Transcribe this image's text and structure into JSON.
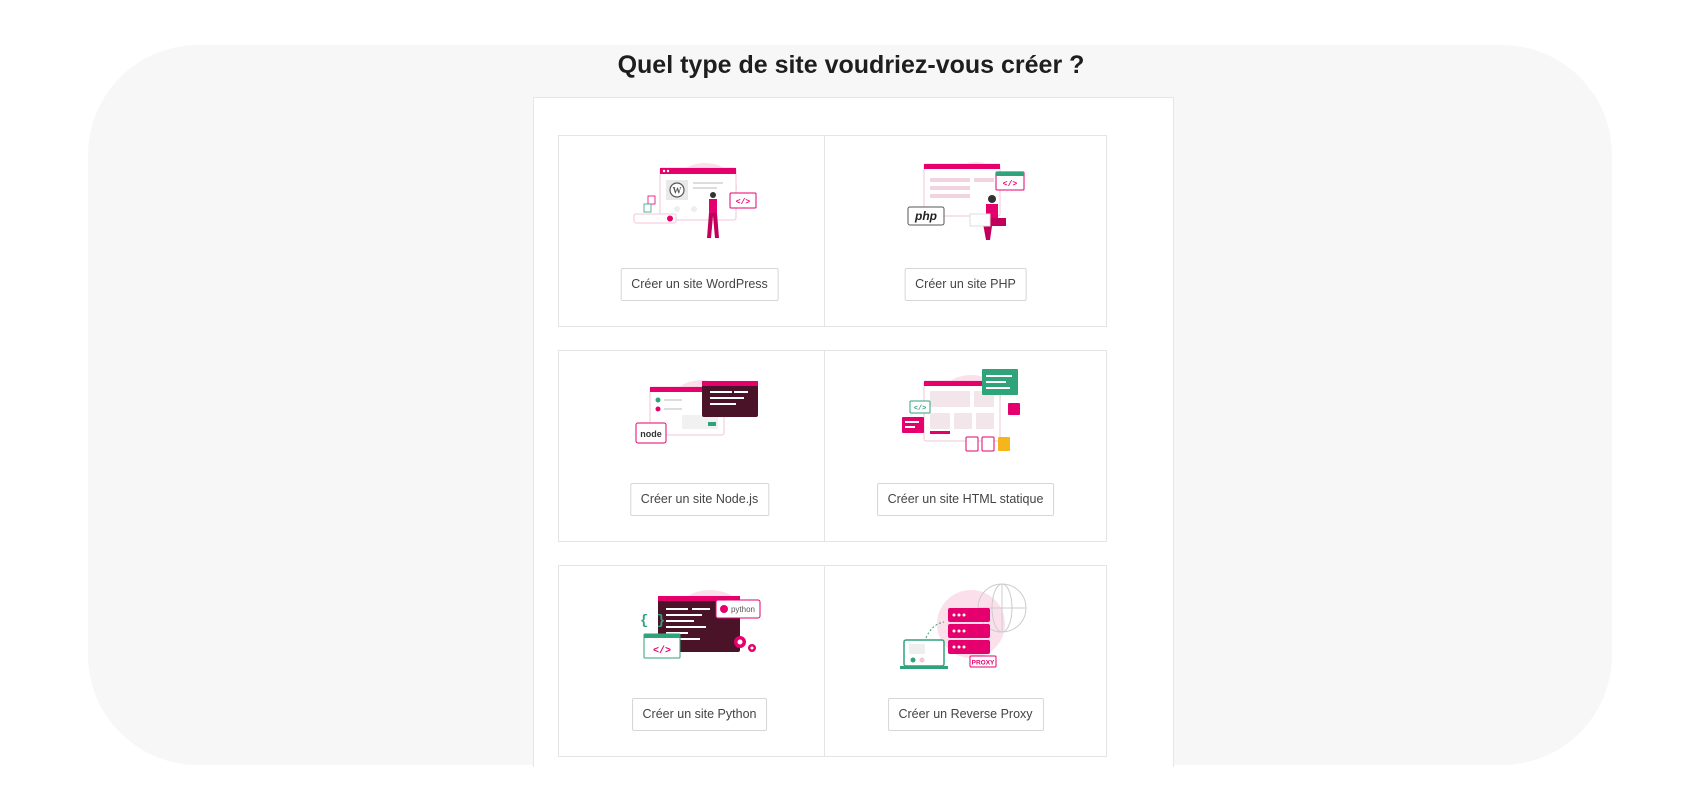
{
  "page": {
    "title": "Quel type de site voudriez-vous créer ?"
  },
  "options": [
    {
      "label": "Créer un site WordPress",
      "icon": "wordpress-illustration",
      "badge": ""
    },
    {
      "label": "Créer un site PHP",
      "icon": "php-illustration",
      "badge": "php"
    },
    {
      "label": "Créer un site Node.js",
      "icon": "nodejs-illustration",
      "badge": "node"
    },
    {
      "label": "Créer un site HTML statique",
      "icon": "html-illustration",
      "badge": "</>"
    },
    {
      "label": "Créer un site Python",
      "icon": "python-illustration",
      "badge": "python"
    },
    {
      "label": "Créer un Reverse Proxy",
      "icon": "reverse-proxy-illustration",
      "badge": "PROXY"
    }
  ],
  "colors": {
    "accent": "#e5006d",
    "accent_dark": "#4a1328",
    "accent_light": "#fbe0ec",
    "secondary": "#2fa37a",
    "panel_bg": "#f8f7f8"
  }
}
